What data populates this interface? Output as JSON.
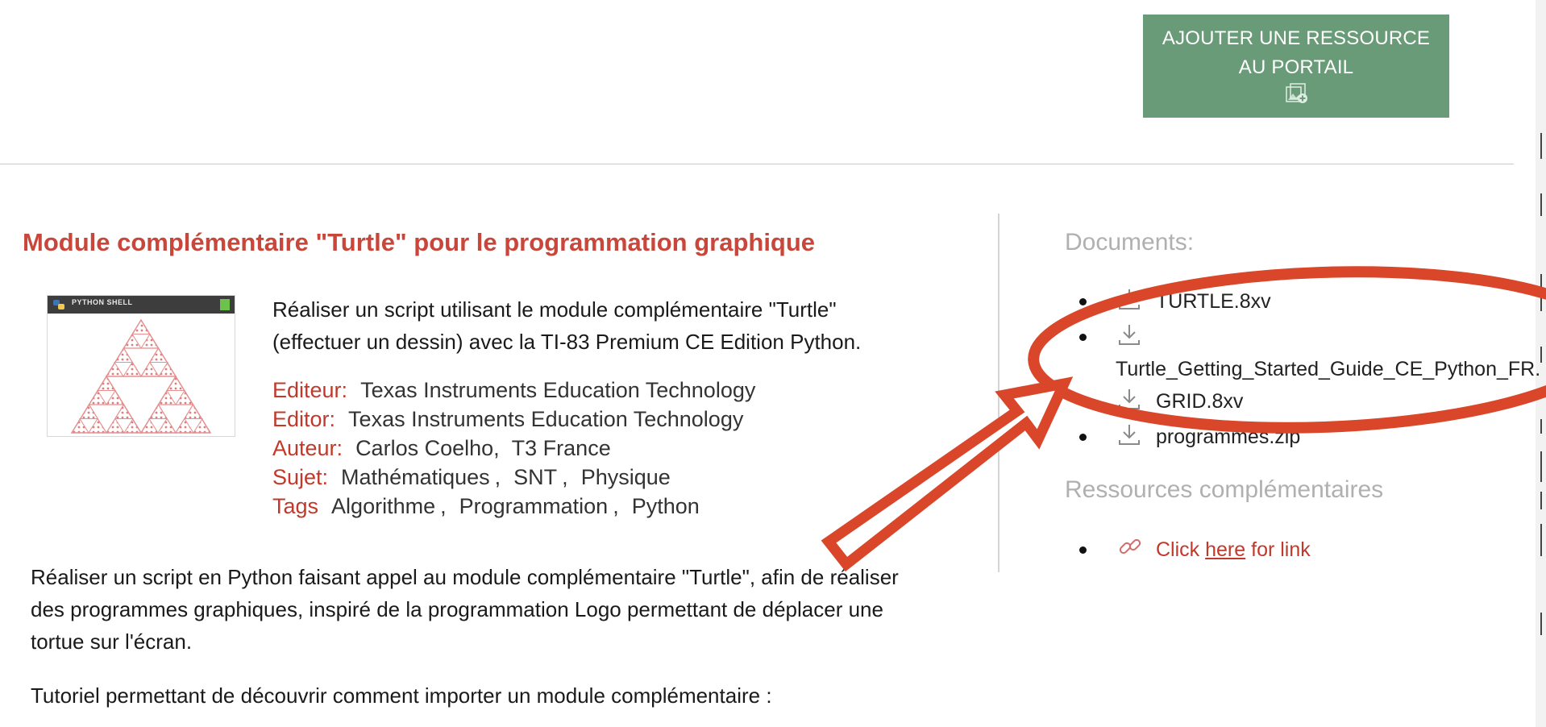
{
  "header": {
    "add_resource_line1": "AJOUTER UNE RESSOURCE",
    "add_resource_line2": "AU PORTAIL",
    "add_resource_icon": "portal-add-icon",
    "button_color": "#6a9b78"
  },
  "resource": {
    "title": "Module complémentaire \"Turtle\" pour le programmation graphique",
    "thumbnail_header": "PYTHON SHELL",
    "summary": "Réaliser un script utilisant le module complémentaire \"Turtle\" (effectuer un dessin) avec la TI-83 Premium CE Edition Python.",
    "meta": {
      "editeur_label": "Editeur:",
      "editeur_value": "Texas Instruments Education Technology",
      "editor_label": "Editor:",
      "editor_value": "Texas Instruments Education Technology",
      "auteur_label": "Auteur:",
      "auteur_values": [
        "Carlos Coelho,",
        "T3 France"
      ],
      "sujet_label": "Sujet:",
      "sujet_values": [
        "Mathématiques",
        "SNT",
        "Physique"
      ],
      "tags_label": "Tags",
      "tags_values": [
        "Algorithme",
        "Programmation",
        "Python"
      ],
      "separator": ","
    },
    "description": "Réaliser un script en Python faisant appel au module complémentaire \"Turtle\", afin de réaliser des programmes graphiques, inspiré de la programmation Logo permettant de déplacer une tortue sur l'écran.",
    "tutorial": "Tutoriel permettant de découvrir comment importer un module complémentaire :",
    "accent_color": "#c8463a"
  },
  "sidebar": {
    "documents_heading": "Documents:",
    "documents": [
      {
        "name": "TURTLE.8xv",
        "icon": "download-icon"
      },
      {
        "name": "Turtle_Getting_Started_Guide_CE_Python_FR.",
        "icon": "download-icon"
      },
      {
        "name": "GRID.8xv",
        "icon": "download-icon"
      },
      {
        "name": "programmes.zip",
        "icon": "download-icon"
      }
    ],
    "complementary_heading": "Ressources complémentaires",
    "link": {
      "icon": "link-icon",
      "prefix": "Click",
      "anchor": "here",
      "suffix": "for link"
    }
  },
  "annotation": {
    "shape": "ellipse-and-arrow",
    "color": "#d9462a"
  }
}
